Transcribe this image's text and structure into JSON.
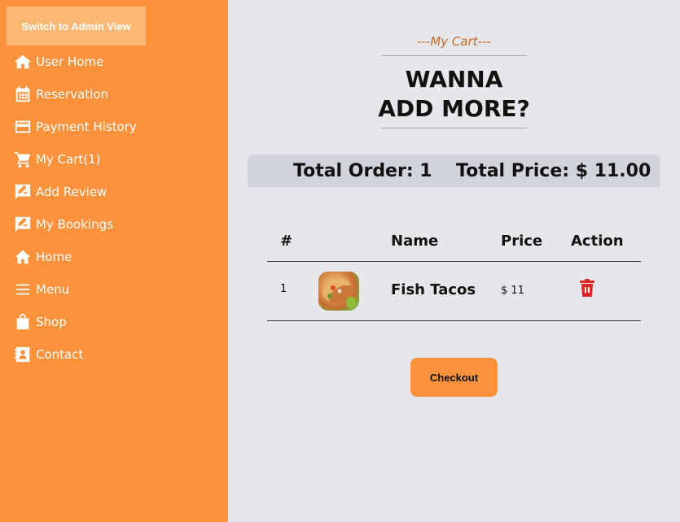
{
  "sidebar": {
    "admin_button": "Switch to Admin View",
    "items": [
      {
        "label": "User Home",
        "icon": "home-icon"
      },
      {
        "label": "Reservation",
        "icon": "calendar-icon"
      },
      {
        "label": "Payment History",
        "icon": "credit-card-icon"
      },
      {
        "label": "My Cart(1)",
        "icon": "cart-icon"
      },
      {
        "label": "Add Review",
        "icon": "review-icon"
      },
      {
        "label": "My Bookings",
        "icon": "review-icon"
      },
      {
        "label": "Home",
        "icon": "home-icon"
      },
      {
        "label": "Menu",
        "icon": "menu-icon"
      },
      {
        "label": "Shop",
        "icon": "shopping-bag-icon"
      },
      {
        "label": "Contact",
        "icon": "contact-book-icon"
      }
    ]
  },
  "main": {
    "subtitle": "---My Cart---",
    "heading_line1": "WANNA",
    "heading_line2": "ADD MORE?",
    "total_order": "Total Order: 1",
    "total_price": "Total Price: $ 11.00",
    "table": {
      "headers": [
        "#",
        "Name",
        "Price",
        "Action"
      ],
      "rows": [
        {
          "index": "1",
          "name": "Fish Tacos",
          "price": "$ 11",
          "image": "fish-tacos-image",
          "action_icon": "trash-icon"
        }
      ]
    },
    "checkout_label": "Checkout"
  },
  "colors": {
    "sidebar_bg": "#fd923d",
    "admin_button_bg": "#fdb876",
    "page_bg": "#e5e7eb",
    "summary_bg": "#d1d5db",
    "subtitle": "#c2692a",
    "delete": "#dc2626",
    "checkout_bg": "#fd923d"
  }
}
